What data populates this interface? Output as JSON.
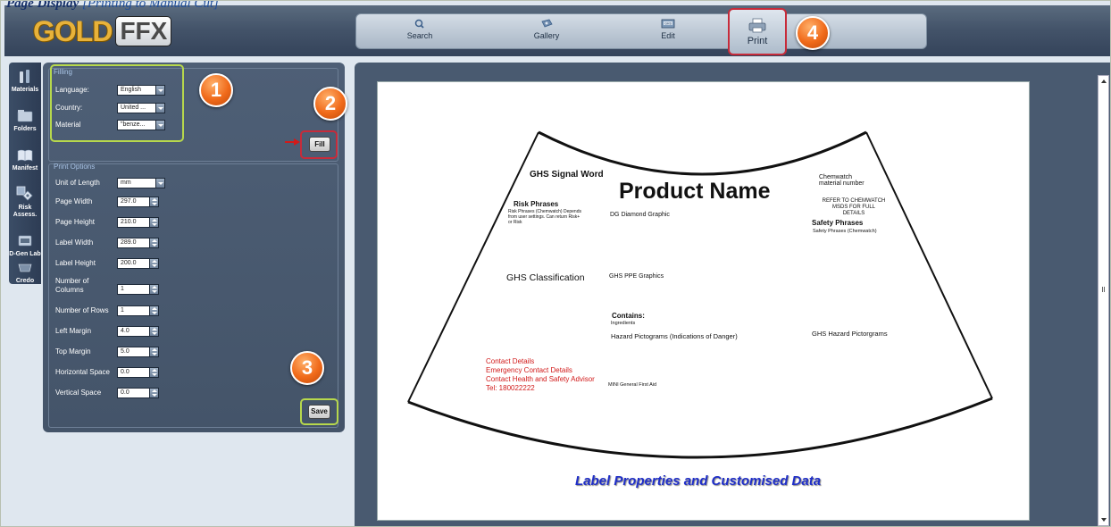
{
  "caption": {
    "bold_text": "Page Display",
    "rest_text": " [Printing to Manual Cut]"
  },
  "logo": {
    "part1": "GOLD",
    "part2": "FFX"
  },
  "toolbar": {
    "items": [
      {
        "label": "Search",
        "icon": "search-icon"
      },
      {
        "label": "Gallery",
        "icon": "gallery-icon"
      },
      {
        "label": "Edit",
        "icon": "edit-icon"
      }
    ],
    "print_label": "Print"
  },
  "callouts": {
    "one": "1",
    "two": "2",
    "three": "3",
    "four": "4"
  },
  "sidebar": {
    "items": [
      {
        "label": "Materials",
        "icon": "materials-icon"
      },
      {
        "label": "Folders",
        "icon": "folders-icon"
      },
      {
        "label": "Manifest",
        "icon": "manifest-icon"
      },
      {
        "label": "Risk Assess.",
        "icon": "risk-icon"
      },
      {
        "label": "D-Gen Lab",
        "icon": "dgen-icon"
      },
      {
        "label": "Credo",
        "icon": "credo-icon"
      }
    ]
  },
  "filling": {
    "title": "Filling",
    "language_label": "Language:",
    "language_value": "English",
    "country_label": "Country:",
    "country_value": "United ...",
    "material_label": "Material",
    "material_value": "\"benze...",
    "fill_button": "Fill"
  },
  "print_options": {
    "title": "Print Options",
    "unit_label": "Unit of Length",
    "unit_value": "mm",
    "page_width_label": "Page Width",
    "page_width": "297.0",
    "page_height_label": "Page Height",
    "page_height": "210.0",
    "label_width_label": "Label Width",
    "label_width": "289.0",
    "label_height_label": "Label Height",
    "label_height": "200.0",
    "columns_label_1": "Number of",
    "columns_label_2": "Columns",
    "columns": "1",
    "rows_label": "Number of Rows",
    "rows": "1",
    "left_margin_label": "Left Margin",
    "left_margin": "4.0",
    "top_margin_label": "Top Margin",
    "top_margin": "5.0",
    "h_space_label": "Horizontal Space",
    "h_space": "0.0",
    "v_space_label": "Vertical Space",
    "v_space": "0.0",
    "save_button": "Save"
  },
  "label": {
    "signal_word": "GHS Signal Word",
    "product_name": "Product Name",
    "chemwatch_1": "Chemwatch",
    "chemwatch_2": "material number",
    "refer_1": "REFER TO CHEMWATCH",
    "refer_2": "MSDS FOR FULL",
    "refer_3": "DETAILS",
    "risk_title": "Risk Phrases",
    "risk_1": "Risk Phrases (Chemwatch) Depends",
    "risk_2": "from user settings. Can return Risk+",
    "risk_3": "or Risk",
    "dg_graphic": "DG Diamond Graphic",
    "safety_title": "Safety Phrases",
    "safety_text": "Safety Phrases (Chemwatch)",
    "classification": "GHS Classification",
    "ppe": "GHS PPE Graphics",
    "contains_title": "Contains:",
    "contains_text": "Ingredients",
    "hazard_text": "Hazard Pictograms (Indications of Danger)",
    "ghs_hazard": "GHS Hazard Pictorgrams",
    "contact_1": "Contact Details",
    "contact_2": "Emergency Contact Details",
    "contact_3": "Contact Health and Safety Advisor",
    "contact_4": "Tel: 180022222",
    "first_aid": "MINI General First Aid"
  },
  "footer_caption": "Label Properties and Customised Data",
  "colors": {
    "accent_red": "#c72b3a",
    "highlight_green": "#b7d84c",
    "callout_orange": "#f06a1a",
    "caption_blue": "#1f2ec8"
  }
}
